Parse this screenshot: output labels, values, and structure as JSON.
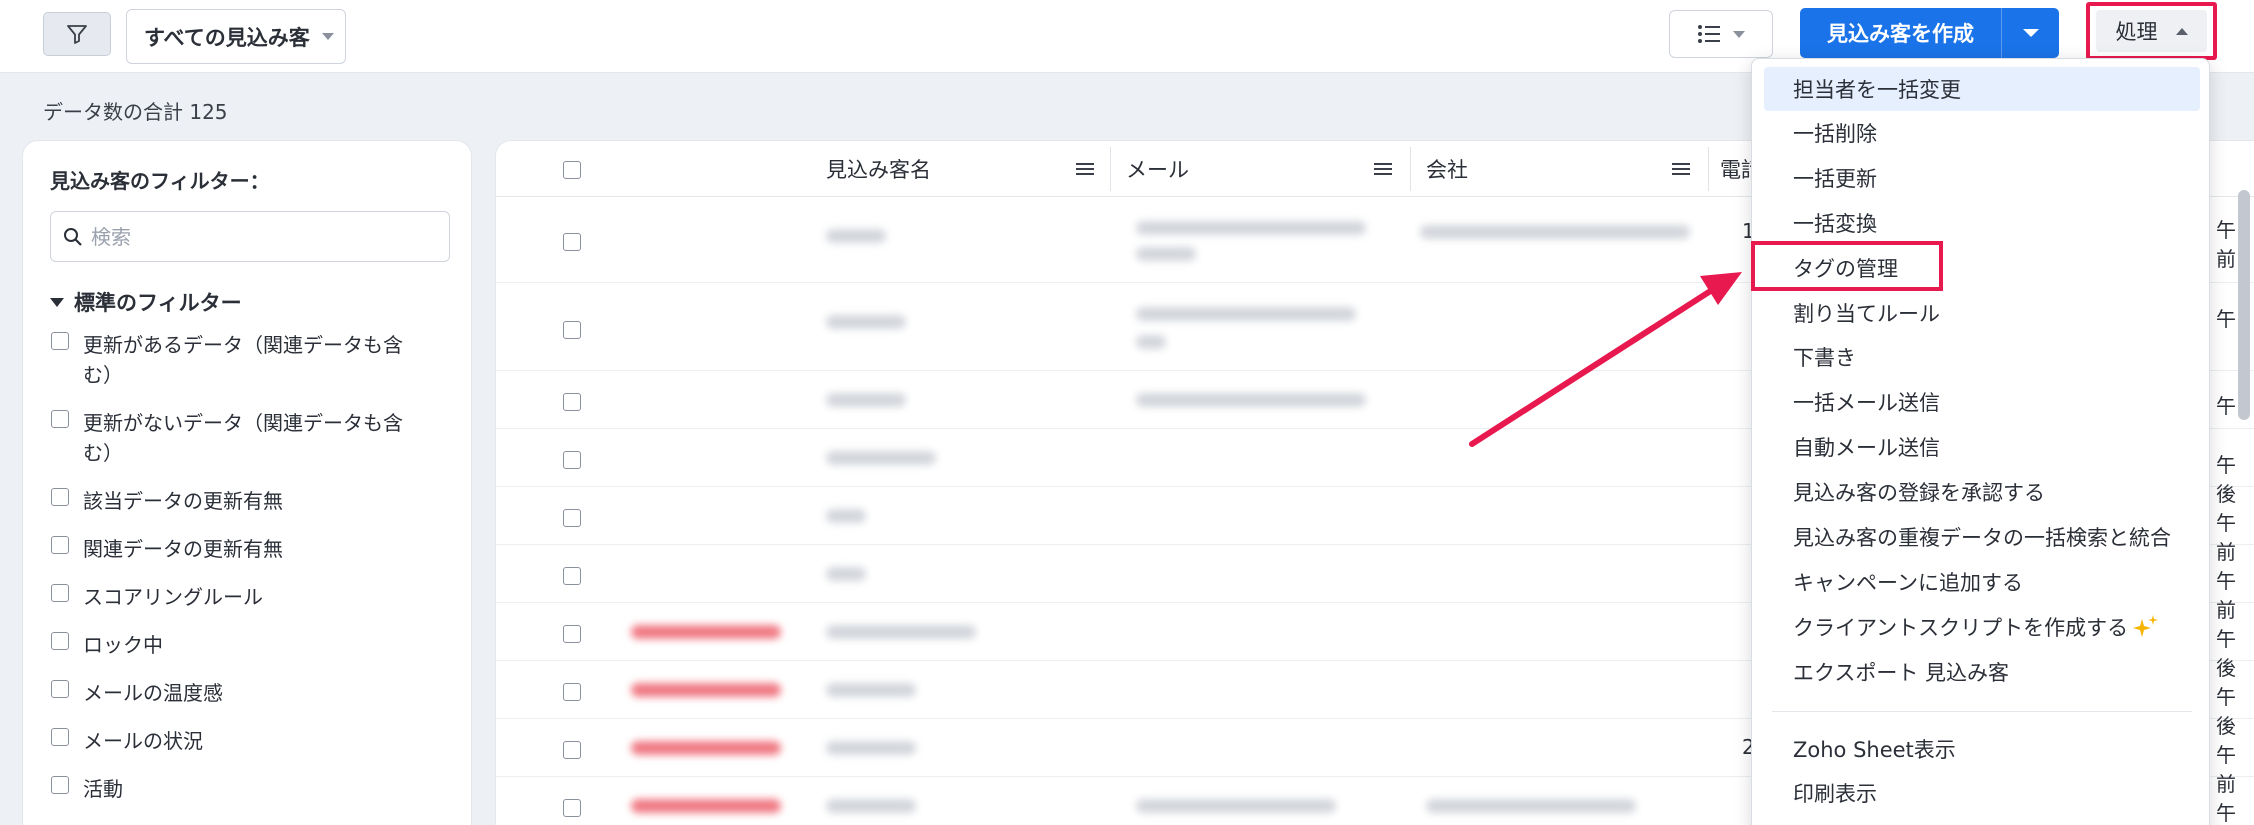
{
  "topbar": {
    "filter_icon": "filter-funnel-icon",
    "view_select_label": "すべての見込み客",
    "listview_icon": "list-view-icon",
    "create_button_label": "見込み客を作成",
    "action_button_label": "処理"
  },
  "summary": {
    "total_label": "データ数の合計 125"
  },
  "filter_panel": {
    "title": "見込み客のフィルター：",
    "search_placeholder": "検索",
    "section_title": "標準のフィルター",
    "items": [
      {
        "label": "更新があるデータ（関連データも含む）"
      },
      {
        "label": "更新がないデータ（関連データも含む）"
      },
      {
        "label": "該当データの更新有無"
      },
      {
        "label": "関連データの更新有無"
      },
      {
        "label": "スコアリングルール"
      },
      {
        "label": "ロック中"
      },
      {
        "label": "メールの温度感"
      },
      {
        "label": "メールの状況"
      },
      {
        "label": "活動"
      }
    ]
  },
  "table": {
    "columns": [
      {
        "label": "見込み客名"
      },
      {
        "label": "メール"
      },
      {
        "label": "会社"
      },
      {
        "label": "電話"
      }
    ],
    "row_fragments": {
      "phone_col": [
        "1:",
        "",
        "",
        "",
        "",
        "",
        "",
        "",
        "2:",
        ""
      ],
      "time_col": [
        "午前",
        "午",
        "午",
        "午後",
        "午前",
        "午前",
        "午後",
        "午後",
        "午前",
        "午前"
      ]
    }
  },
  "action_menu": {
    "items": [
      {
        "label": "担当者を一括変更"
      },
      {
        "label": "一括削除"
      },
      {
        "label": "一括更新"
      },
      {
        "label": "一括変換"
      },
      {
        "label": "タグの管理"
      },
      {
        "label": "割り当てルール"
      },
      {
        "label": "下書き"
      },
      {
        "label": "一括メール送信"
      },
      {
        "label": "自動メール送信"
      },
      {
        "label": "見込み客の登録を承認する"
      },
      {
        "label": "見込み客の重複データの一括検索と統合"
      },
      {
        "label": "キャンペーンに追加する"
      },
      {
        "label": "クライアントスクリプトを作成する"
      },
      {
        "label": "エクスポート 見込み客"
      }
    ],
    "secondary_items": [
      {
        "label": "Zoho Sheet表示"
      },
      {
        "label": "印刷表示"
      }
    ],
    "sparkle_icon": "sparkle-icon"
  },
  "colors": {
    "accent": "#1a73e8",
    "highlight": "#e8194e",
    "menu_active": "#e6effd"
  }
}
